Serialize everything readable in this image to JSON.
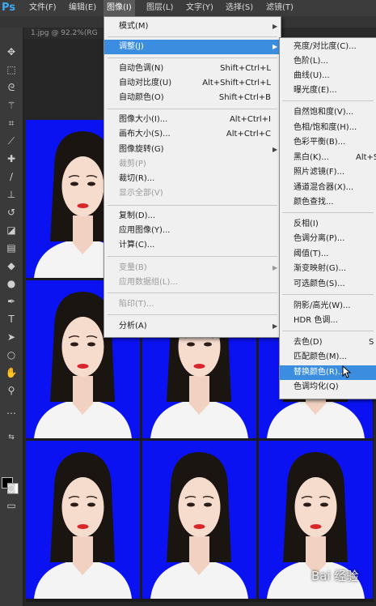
{
  "app": {
    "logo": "Ps"
  },
  "menubar": [
    {
      "label": "文件(F)"
    },
    {
      "label": "编辑(E)"
    },
    {
      "label": "图像(I)"
    },
    {
      "label": "图层(L)"
    },
    {
      "label": "文字(Y)"
    },
    {
      "label": "选择(S)"
    },
    {
      "label": "滤镜(T)"
    }
  ],
  "document_tab": {
    "title": "1.jpg @ 92.2%(RG"
  },
  "image_menu": {
    "items": [
      {
        "label": "模式(M)",
        "shortcut": "",
        "submenu": true,
        "disabled": false
      },
      {
        "label": "调整(J)",
        "shortcut": "",
        "submenu": true,
        "disabled": false,
        "selected": true
      },
      {
        "label": "自动色调(N)",
        "shortcut": "Shift+Ctrl+L",
        "disabled": false
      },
      {
        "label": "自动对比度(U)",
        "shortcut": "Alt+Shift+Ctrl+L",
        "disabled": false
      },
      {
        "label": "自动颜色(O)",
        "shortcut": "Shift+Ctrl+B",
        "disabled": false
      },
      {
        "label": "图像大小(I)...",
        "shortcut": "Alt+Ctrl+I",
        "disabled": false
      },
      {
        "label": "画布大小(S)...",
        "shortcut": "Alt+Ctrl+C",
        "disabled": false
      },
      {
        "label": "图像旋转(G)",
        "shortcut": "",
        "submenu": true,
        "disabled": false
      },
      {
        "label": "裁剪(P)",
        "shortcut": "",
        "disabled": true
      },
      {
        "label": "裁切(R)...",
        "shortcut": "",
        "disabled": false
      },
      {
        "label": "显示全部(V)",
        "shortcut": "",
        "disabled": true
      },
      {
        "label": "复制(D)...",
        "shortcut": "",
        "disabled": false
      },
      {
        "label": "应用图像(Y)...",
        "shortcut": "",
        "disabled": false
      },
      {
        "label": "计算(C)...",
        "shortcut": "",
        "disabled": false
      },
      {
        "label": "变量(B)",
        "shortcut": "",
        "submenu": true,
        "disabled": true
      },
      {
        "label": "应用数据组(L)...",
        "shortcut": "",
        "disabled": true
      },
      {
        "label": "陷印(T)...",
        "shortcut": "",
        "disabled": true
      },
      {
        "label": "分析(A)",
        "shortcut": "",
        "submenu": true,
        "disabled": false
      }
    ]
  },
  "adjust_submenu": {
    "items": [
      {
        "label": "亮度/对比度(C)..."
      },
      {
        "label": "色阶(L)..."
      },
      {
        "label": "曲线(U)..."
      },
      {
        "label": "曝光度(E)..."
      },
      {
        "label": "自然饱和度(V)..."
      },
      {
        "label": "色相/饱和度(H)..."
      },
      {
        "label": "色彩平衡(B)..."
      },
      {
        "label": "黑白(K)...",
        "shortcut": "Alt+S"
      },
      {
        "label": "照片滤镜(F)..."
      },
      {
        "label": "通道混合器(X)..."
      },
      {
        "label": "颜色查找..."
      },
      {
        "label": "反相(I)"
      },
      {
        "label": "色调分离(P)..."
      },
      {
        "label": "阈值(T)..."
      },
      {
        "label": "渐变映射(G)..."
      },
      {
        "label": "可选颜色(S)..."
      },
      {
        "label": "阴影/高光(W)..."
      },
      {
        "label": "HDR 色调..."
      },
      {
        "label": "去色(D)",
        "shortcut": "S"
      },
      {
        "label": "匹配颜色(M)..."
      },
      {
        "label": "替换颜色(R)...",
        "highlighted": true
      },
      {
        "label": "色调均化(Q)"
      }
    ]
  },
  "watermark": {
    "text": "Bai 经验"
  },
  "colors": {
    "photo_background": "#0a12f2",
    "menu_highlight": "#3b8de0"
  }
}
